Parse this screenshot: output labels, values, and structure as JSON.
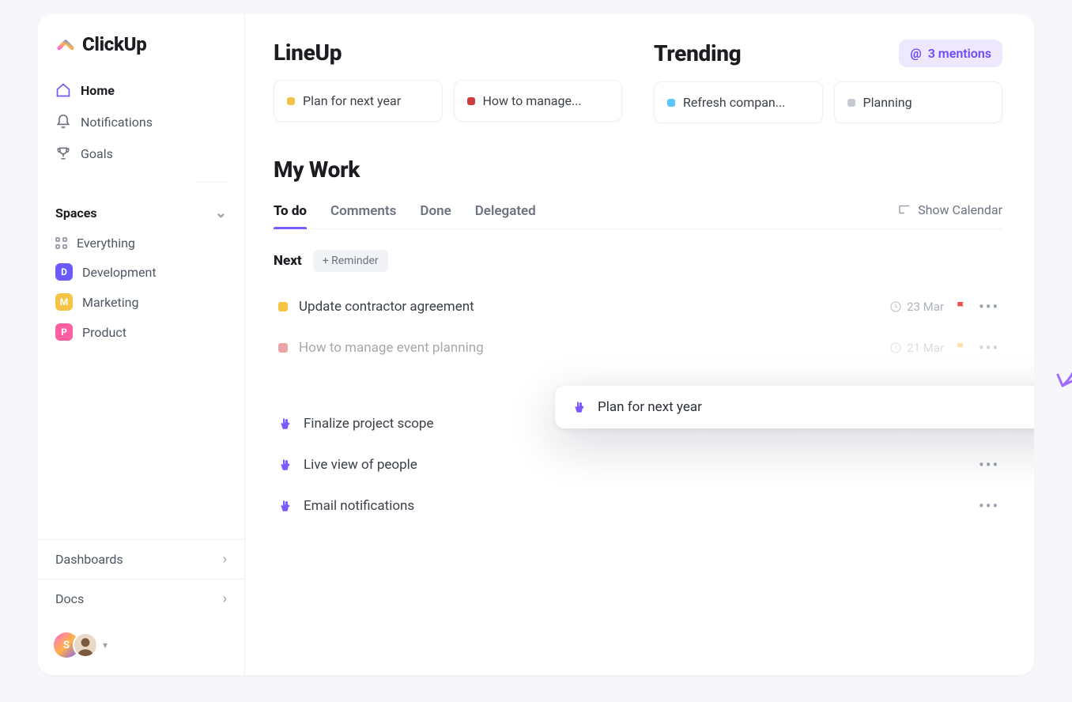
{
  "brand": {
    "name": "ClickUp"
  },
  "sidebar": {
    "nav": [
      {
        "label": "Home"
      },
      {
        "label": "Notifications"
      },
      {
        "label": "Goals"
      }
    ],
    "spaces_header": "Spaces",
    "everything_label": "Everything",
    "spaces": [
      {
        "letter": "D",
        "label": "Development",
        "color": "#6b5bff"
      },
      {
        "letter": "M",
        "label": "Marketing",
        "color": "#f6c445"
      },
      {
        "letter": "P",
        "label": "Product",
        "color": "#ff5ea1"
      }
    ],
    "bottom": [
      {
        "label": "Dashboards"
      },
      {
        "label": "Docs"
      }
    ],
    "user_initial": "S"
  },
  "lineup": {
    "title": "LineUp",
    "cards": [
      {
        "label": "Plan for next year",
        "color": "#f6c445"
      },
      {
        "label": "How to manage...",
        "color": "#d23b3b"
      }
    ]
  },
  "trending": {
    "title": "Trending",
    "cards": [
      {
        "label": "Refresh compan...",
        "color": "#5bc6ff"
      },
      {
        "label": "Planning",
        "color": "#c6cad2"
      }
    ]
  },
  "mentions": {
    "label": "3 mentions"
  },
  "mywork": {
    "title": "My Work",
    "tabs": [
      "To do",
      "Comments",
      "Done",
      "Delegated"
    ],
    "show_calendar": "Show Calendar",
    "next_label": "Next",
    "reminder_label": "+ Reminder",
    "tasks": [
      {
        "title": "Update contractor agreement",
        "color": "#f6c445",
        "date": "23 Mar",
        "flag": "#ef4d4d",
        "type": "square"
      },
      {
        "title": "How to manage event planning",
        "color": "#d23b3b",
        "date": "21 Mar",
        "flag": "#f6c445",
        "type": "square"
      },
      {
        "title": "Finalize project scope",
        "type": "hand"
      },
      {
        "title": "Live view of people",
        "type": "hand"
      },
      {
        "title": "Email notifications",
        "type": "hand"
      }
    ]
  },
  "popup": {
    "title": "Plan for next year"
  }
}
